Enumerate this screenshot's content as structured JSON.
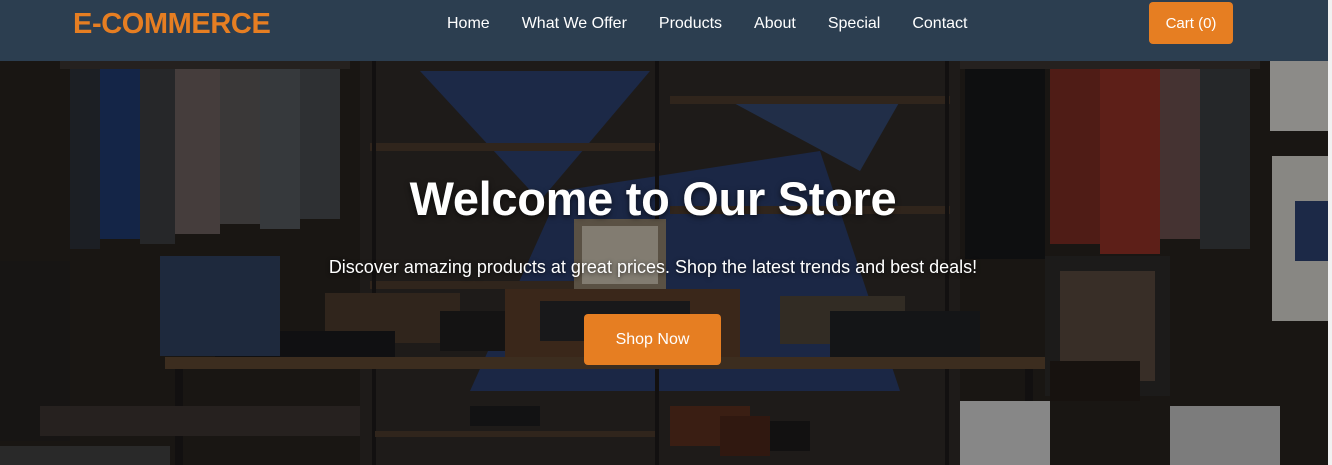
{
  "brand": {
    "logo_text": "E-COMMERCE",
    "accent_color": "#e67e22",
    "header_bg": "#2c3e50"
  },
  "nav": {
    "items": [
      {
        "label": "Home"
      },
      {
        "label": "What We Offer"
      },
      {
        "label": "Products"
      },
      {
        "label": "About"
      },
      {
        "label": "Special"
      },
      {
        "label": "Contact"
      }
    ]
  },
  "cart": {
    "label": "Cart (0)"
  },
  "hero": {
    "title": "Welcome to Our Store",
    "subtitle": "Discover amazing products at great prices. Shop the latest trends and best deals!",
    "cta_label": "Shop Now"
  }
}
